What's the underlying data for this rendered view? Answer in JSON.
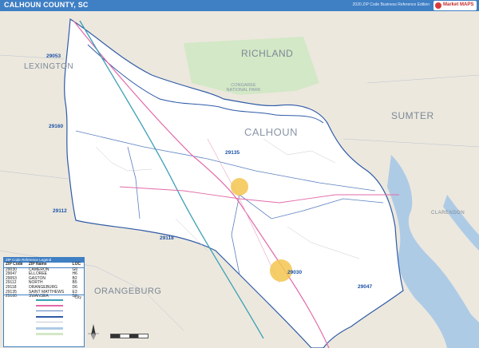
{
  "header": {
    "title": "CALHOUN COUNTY, SC",
    "edition": "2020 ZIP Code Business Reference Edition",
    "logo_text": "Market MAPS",
    "accent_color": "#3f7fc4"
  },
  "map": {
    "regions": {
      "richland": "RICHLAND",
      "lexington": "LEXINGTON",
      "sumter": "SUMTER",
      "clarendon": "CLARENDON",
      "orangeburg": "ORANGEBURG"
    },
    "county": "CALHOUN",
    "place_labels": {
      "congaree": "CONGAREE NATIONAL PARK"
    },
    "zip_labels": [
      "29053",
      "29160",
      "29135",
      "29112",
      "29118",
      "29030",
      "29047"
    ],
    "colors": {
      "county_fill": "#ffffff",
      "outside_fill": "#ece8de",
      "park_fill": "#d3e8c6",
      "water": "#aecbe6",
      "county_border": "#2e5aa7",
      "zip_border": "#5a7fc0",
      "highway": "#e26aa8",
      "interstate": "#3a9fb5"
    }
  },
  "legend": {
    "header": "ZIP Code Reference Legend",
    "columns": [
      "ZIP Code",
      "ZIP Name",
      "LOC"
    ],
    "rows": [
      [
        "29030",
        "CAMERON",
        "G6"
      ],
      [
        "29047",
        "ELLOREE",
        "H6"
      ],
      [
        "29053",
        "GASTON",
        "B2"
      ],
      [
        "29112",
        "NORTH",
        "B5"
      ],
      [
        "29118",
        "ORANGEBURG",
        "D6"
      ],
      [
        "29135",
        "SAINT MATTHEWS",
        "E3"
      ],
      [
        "29160",
        "SWANSEA",
        "B3"
      ]
    ],
    "city_label": "City"
  }
}
